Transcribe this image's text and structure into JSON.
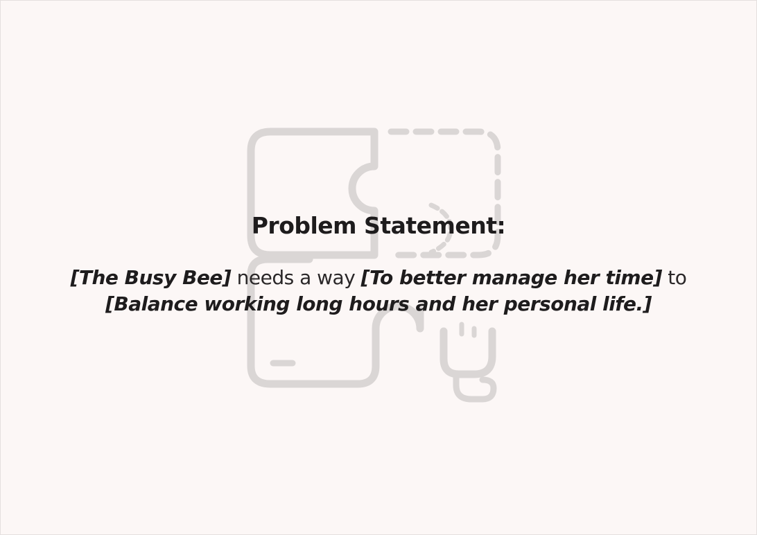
{
  "slide": {
    "title": "Problem Statement:",
    "statement": {
      "user": "[The Busy Bee]",
      "connector_1": " needs a way ",
      "need": "[To better manage her time]",
      "connector_2": " to",
      "insight": "[Balance working long hours and her personal life.]"
    },
    "background_icon": "puzzle-pieces-icon"
  }
}
